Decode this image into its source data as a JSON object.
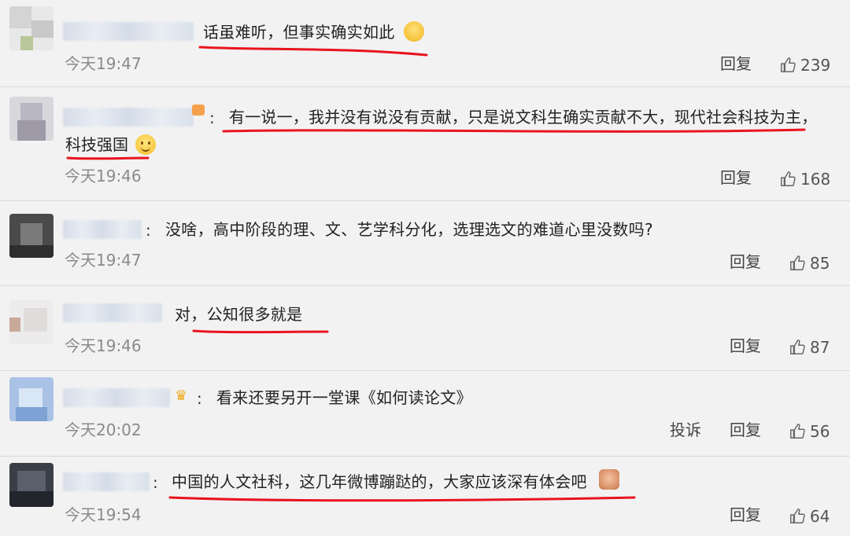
{
  "comments": [
    {
      "text": "话虽难听，但事实确实如此",
      "time": "今天19:47",
      "actions": [
        "回复"
      ],
      "likes": "239",
      "emoji": "laughing-crying-emoji"
    },
    {
      "text": "有一说一，我并没有说没有贡献，只是说文科生确实贡献不大，现代社会科技为主，",
      "text_line2": "科技强国",
      "time": "今天19:46",
      "actions": [
        "回复"
      ],
      "likes": "168",
      "badge": "orange-badge-icon",
      "emoji": "smiley-emoji"
    },
    {
      "text": "没啥，高中阶段的理、文、艺学科分化，选理选文的难道心里没数吗?",
      "time": "今天19:47",
      "actions": [
        "回复"
      ],
      "likes": "85"
    },
    {
      "text": "对，公知很多就是",
      "time": "今天19:46",
      "actions": [
        "回复"
      ],
      "likes": "87"
    },
    {
      "text": "看来还要另开一堂课《如何读论文》",
      "time": "今天20:02",
      "actions": [
        "投诉",
        "回复"
      ],
      "likes": "56",
      "badge": "crown-icon"
    },
    {
      "text": "中国的人文社科，这几年微博蹦跶的，大家应该深有体会吧",
      "time": "今天19:54",
      "actions": [
        "回复"
      ],
      "likes": "64",
      "emoji": "doge-emoji"
    }
  ],
  "colors": {
    "background": "#f2f2f2",
    "underline": "#e8141e",
    "time": "#8a8a8a"
  }
}
